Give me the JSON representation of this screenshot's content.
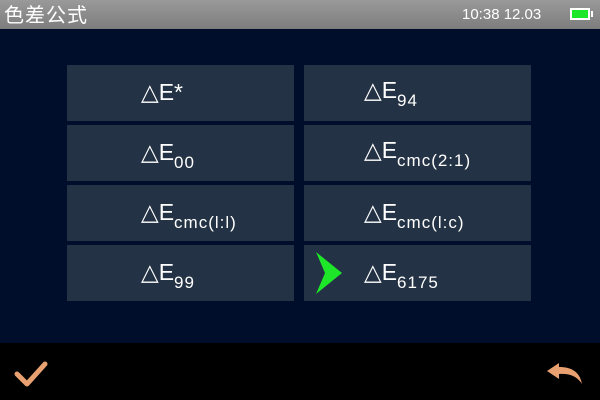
{
  "header": {
    "title": "色差公式",
    "time": "10:38 12.03",
    "battery_icon": "battery-full-icon",
    "battery_color": "#1ee628"
  },
  "formulas": [
    {
      "id": "deltaE-star",
      "symbol": "△E",
      "suffix": "*",
      "subscript": ""
    },
    {
      "id": "deltaE-94",
      "symbol": "△E",
      "suffix": "",
      "subscript": "94"
    },
    {
      "id": "deltaE-00",
      "symbol": "△E",
      "suffix": "",
      "subscript": "00"
    },
    {
      "id": "deltaE-cmc-2-1",
      "symbol": "△E",
      "suffix": "",
      "subscript": "cmc(2:1)"
    },
    {
      "id": "deltaE-cmc-l-l",
      "symbol": "△E",
      "suffix": "",
      "subscript": "cmc(l:l)"
    },
    {
      "id": "deltaE-cmc-l-c",
      "symbol": "△E",
      "suffix": "",
      "subscript": "cmc(l:c)"
    },
    {
      "id": "deltaE-99",
      "symbol": "△E",
      "suffix": "",
      "subscript": "99"
    },
    {
      "id": "deltaE-6175",
      "symbol": "△E",
      "suffix": "",
      "subscript": "6175"
    }
  ],
  "selected_formula": "deltaE-6175",
  "footer": {
    "confirm_icon": "checkmark-icon",
    "back_icon": "return-arrow-icon",
    "icon_color": "#e8a070"
  },
  "colors": {
    "button_bg": "#233244",
    "panel_bg": "#000d2b",
    "selector": "#1ee628"
  }
}
